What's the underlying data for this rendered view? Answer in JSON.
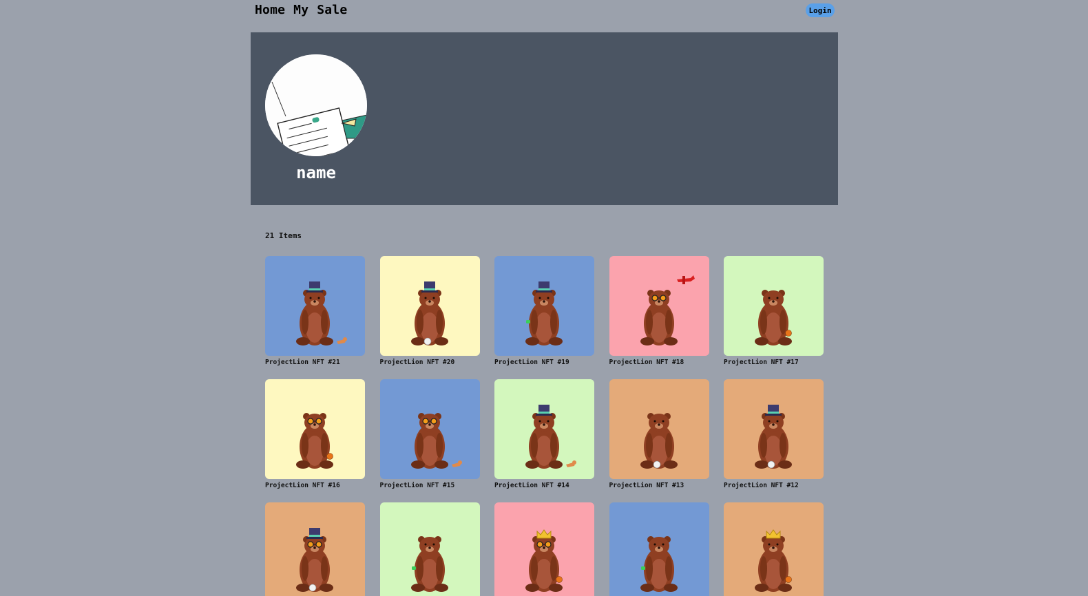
{
  "nav": {
    "links": [
      "Home",
      "My",
      "Sale"
    ],
    "login_label": "Login"
  },
  "profile": {
    "name": "name"
  },
  "items_count_label": "21 Items",
  "colors": {
    "blue": "#7399d4",
    "yellow": "#fef8c0",
    "pink": "#fba3ad",
    "green": "#d3f7bd",
    "orange": "#e4aa79",
    "banner": "#4b5563",
    "page_bg": "#9ba1ac"
  },
  "items": [
    {
      "title": "ProjectLion NFT #21",
      "bg": "blue",
      "hat": "tophat",
      "glasses": false,
      "extra": "fox"
    },
    {
      "title": "ProjectLion NFT #20",
      "bg": "yellow",
      "hat": "tophat",
      "glasses": false,
      "extra": "skull"
    },
    {
      "title": "ProjectLion NFT #19",
      "bg": "blue",
      "hat": "tophat",
      "glasses": false,
      "extra": "frog"
    },
    {
      "title": "ProjectLion NFT #18",
      "bg": "pink",
      "hat": "plane",
      "glasses": true,
      "extra": "none"
    },
    {
      "title": "ProjectLion NFT #17",
      "bg": "green",
      "hat": "none",
      "glasses": false,
      "extra": "ball"
    },
    {
      "title": "ProjectLion NFT #16",
      "bg": "yellow",
      "hat": "none",
      "glasses": true,
      "extra": "ball"
    },
    {
      "title": "ProjectLion NFT #15",
      "bg": "blue",
      "hat": "none",
      "glasses": true,
      "extra": "fox"
    },
    {
      "title": "ProjectLion NFT #14",
      "bg": "green",
      "hat": "tophat",
      "glasses": false,
      "extra": "fox"
    },
    {
      "title": "ProjectLion NFT #13",
      "bg": "orange",
      "hat": "none",
      "glasses": false,
      "extra": "skull"
    },
    {
      "title": "ProjectLion NFT #12",
      "bg": "orange",
      "hat": "tophat",
      "glasses": false,
      "extra": "skull"
    },
    {
      "title": "",
      "bg": "orange",
      "hat": "tophat",
      "glasses": true,
      "extra": "skull"
    },
    {
      "title": "",
      "bg": "green",
      "hat": "none",
      "glasses": false,
      "extra": "frog"
    },
    {
      "title": "",
      "bg": "pink",
      "hat": "crown",
      "glasses": true,
      "extra": "ball"
    },
    {
      "title": "",
      "bg": "blue",
      "hat": "none",
      "glasses": false,
      "extra": "frog"
    },
    {
      "title": "",
      "bg": "orange",
      "hat": "crown",
      "glasses": false,
      "extra": "ball"
    }
  ]
}
